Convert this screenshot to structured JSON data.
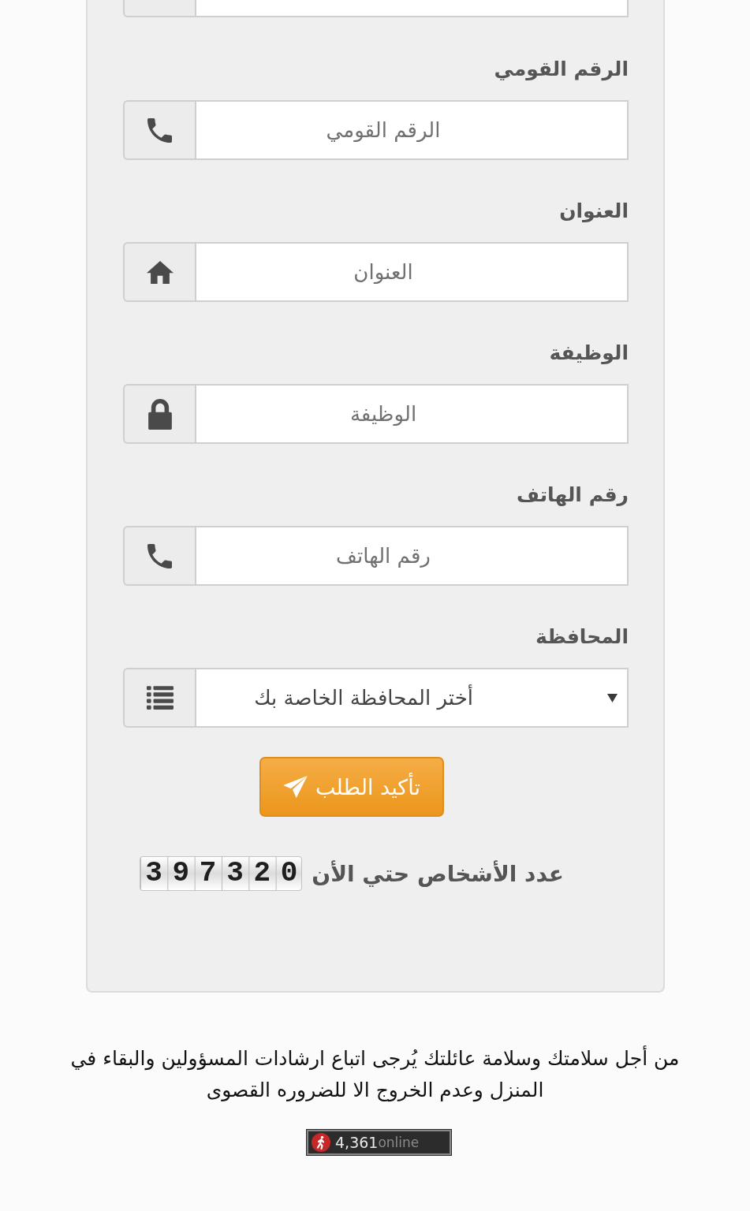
{
  "form": {
    "fields": [
      {
        "kind": "cut-off"
      },
      {
        "kind": "input",
        "label": "الرقم القومي",
        "placeholder": "الرقم القومي"
      },
      {
        "kind": "input",
        "label": "العنوان",
        "placeholder": "العنوان"
      },
      {
        "kind": "input",
        "label": "الوظيفة",
        "placeholder": "الوظيفة"
      },
      {
        "kind": "input",
        "label": "رقم الهاتف",
        "placeholder": "رقم الهاتف"
      },
      {
        "kind": "select",
        "label": "المحافظة",
        "value": "أختر المحافظة الخاصة بك"
      }
    ],
    "submit_button": {
      "label": "تأكيد الطلب"
    },
    "visitor_counter": {
      "label": "عدد الأشخاص حتي الأن",
      "digits": "397320"
    }
  },
  "notice": "من أجل سلامتك وسلامة عائلتك يُرجى اتباع ارشادات المسؤولين والبقاء في المنزل وعدم الخروج الا للضروره القصوى",
  "online_badge": {
    "count": "4,361",
    "label": "online"
  }
}
